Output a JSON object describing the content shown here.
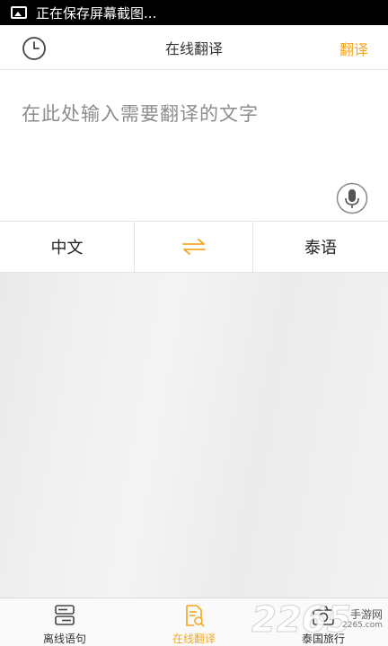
{
  "status_bar": {
    "notification_text": "正在保存屏幕截图..."
  },
  "header": {
    "title": "在线翻译",
    "translate_label": "翻译",
    "accent_color": "#f5a623"
  },
  "input": {
    "placeholder": "在此处输入需要翻译的文字"
  },
  "languages": {
    "source": "中文",
    "target": "泰语"
  },
  "tabs": [
    {
      "label": "离线语句",
      "icon": "phrase-book-icon",
      "active": false
    },
    {
      "label": "在线翻译",
      "icon": "translate-doc-icon",
      "active": true
    },
    {
      "label": "泰国旅行",
      "icon": "camera-icon",
      "active": false
    }
  ],
  "watermark": {
    "number": "2265",
    "site": "手游网",
    "domain": "2265.com"
  }
}
